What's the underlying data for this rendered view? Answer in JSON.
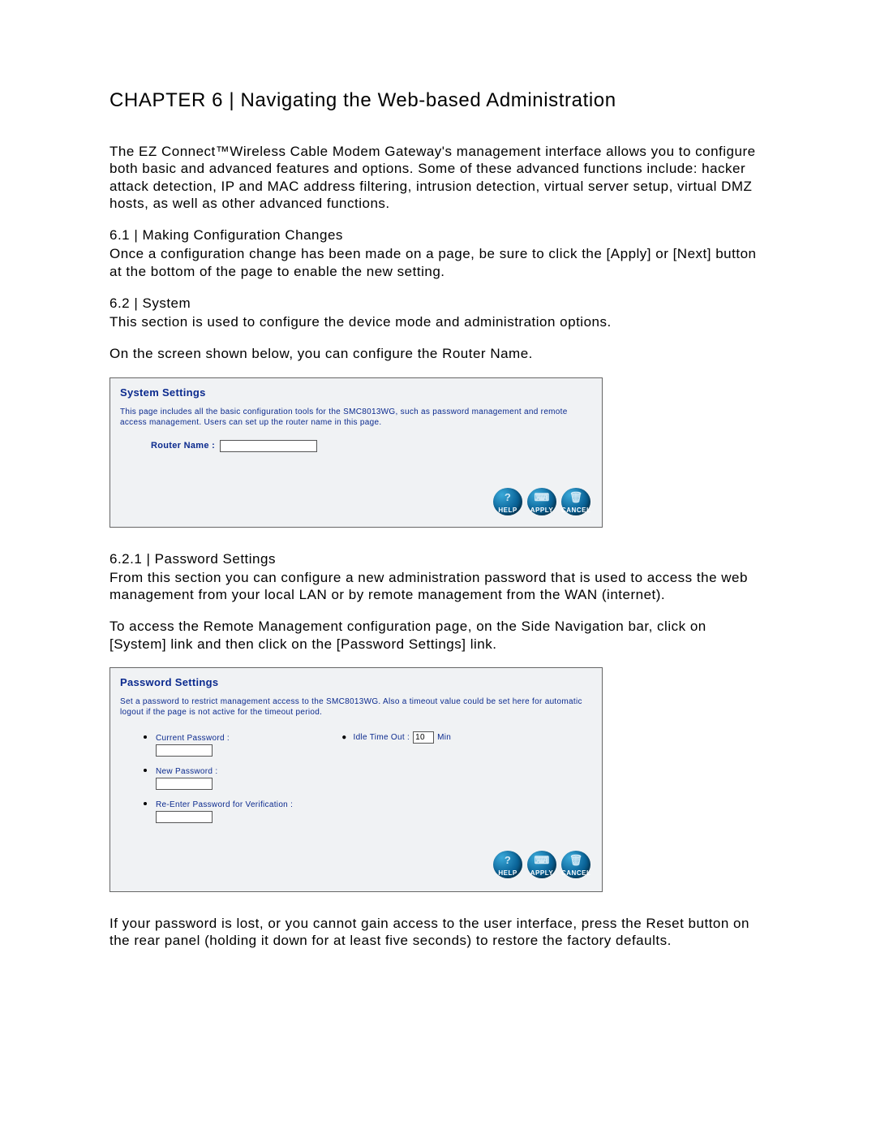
{
  "chapter_title": "CHAPTER 6 | Navigating the Web-based Administration",
  "intro": "The EZ Connect™Wireless Cable Modem Gateway's management interface allows you to configure both basic and advanced features and options. Some of these advanced functions include: hacker attack detection, IP and MAC address filtering, intrusion detection, virtual server setup, virtual DMZ hosts, as well as other advanced functions.",
  "s61_head": "6.1 | Making Configuration Changes",
  "s61_body": "Once a configuration change has been made on a page, be sure to click the [Apply] or [Next] button at the bottom of the page to enable the new setting.",
  "s62_head": "6.2 | System",
  "s62_body1": "This section is used to configure the device mode and administration options.",
  "s62_body2": "On the screen shown below, you can configure the Router Name.",
  "panel_system": {
    "title": "System Settings",
    "desc": "This page includes all the basic configuration tools for the SMC8013WG, such as password management and remote access management. Users can set up the router name in this page.",
    "router_label": "Router Name :"
  },
  "buttons": {
    "help": "HELP",
    "apply": "APPLY",
    "cancel": "CANCEL",
    "help_glyph": "?",
    "apply_glyph": "⌨",
    "cancel_glyph": "🗑"
  },
  "s621_head": "6.2.1 | Password Settings",
  "s621_body1": "From this section you can configure a new administration password that is used to access the web management from your local LAN or by remote management from the WAN (internet).",
  "s621_body2": "To access the Remote Management configuration page, on the Side Navigation bar, click on [System] link and then click on the [Password Settings] link.",
  "panel_password": {
    "title": "Password Settings",
    "desc": "Set a password to restrict management access to the SMC8013WG. Also a timeout value could be set here for automatic logout if the page is not active for the timeout period.",
    "current": "Current Password :",
    "newpwd": "New Password :",
    "reenter": "Re-Enter Password for Verification :",
    "idle_label": "Idle Time Out :",
    "idle_value": "10",
    "idle_unit": "Min"
  },
  "outro": "If your password is lost, or you cannot gain access to the user interface, press the Reset button on the rear panel (holding it down for at least five seconds) to restore the factory defaults."
}
